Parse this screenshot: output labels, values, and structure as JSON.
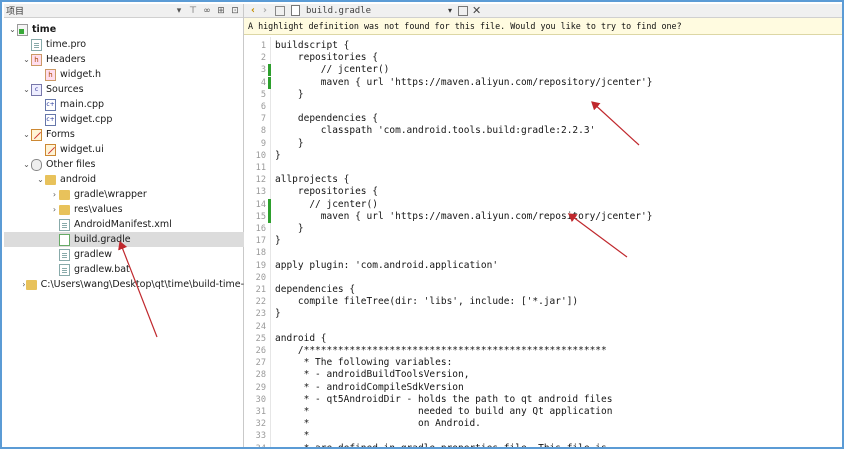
{
  "project_pane": {
    "title": "项目",
    "tree": [
      {
        "label": "time",
        "icon": "project-icon",
        "level": 0,
        "expanded": true,
        "bold": true
      },
      {
        "label": "time.pro",
        "icon": "pro-file-icon",
        "level": 1
      },
      {
        "label": "Headers",
        "icon": "headers-folder-icon",
        "level": 1,
        "expanded": true
      },
      {
        "label": "widget.h",
        "icon": "header-file-icon",
        "level": 2
      },
      {
        "label": "Sources",
        "icon": "sources-folder-icon",
        "level": 1,
        "expanded": true
      },
      {
        "label": "main.cpp",
        "icon": "cpp-file-icon",
        "level": 2
      },
      {
        "label": "widget.cpp",
        "icon": "cpp-file-icon",
        "level": 2
      },
      {
        "label": "Forms",
        "icon": "forms-folder-icon",
        "level": 1,
        "expanded": true
      },
      {
        "label": "widget.ui",
        "icon": "ui-file-icon",
        "level": 2
      },
      {
        "label": "Other files",
        "icon": "other-files-icon",
        "level": 1,
        "expanded": true
      },
      {
        "label": "android",
        "icon": "folder-icon",
        "level": 2,
        "expanded": true
      },
      {
        "label": "gradle\\wrapper",
        "icon": "folder-icon",
        "level": 3,
        "collapsed": true
      },
      {
        "label": "res\\values",
        "icon": "folder-icon",
        "level": 3,
        "collapsed": true
      },
      {
        "label": "AndroidManifest.xml",
        "icon": "xml-file-icon",
        "level": 3
      },
      {
        "label": "build.gradle",
        "icon": "gradle-file-icon",
        "level": 3,
        "selected": true
      },
      {
        "label": "gradlew",
        "icon": "file-icon",
        "level": 3
      },
      {
        "label": "gradlew.bat",
        "icon": "bat-file-icon",
        "level": 3
      },
      {
        "label": "C:\\Users\\wang\\Desktop\\qt\\time\\build-time-",
        "icon": "folder-icon",
        "level": 1,
        "collapsed": true
      }
    ]
  },
  "editor": {
    "file_name": "build.gradle",
    "info_message": "A highlight definition was not found for this file. Would you like to try to find one?",
    "lines": [
      {
        "n": "1",
        "text": "buildscript {"
      },
      {
        "n": "2",
        "text": "    repositories {"
      },
      {
        "n": "3",
        "text": "        // jcenter()",
        "changed": true
      },
      {
        "n": "4",
        "text": "        maven { url 'https://maven.aliyun.com/repository/jcenter'}",
        "changed": true
      },
      {
        "n": "5",
        "text": "    }"
      },
      {
        "n": "6",
        "text": ""
      },
      {
        "n": "7",
        "text": "    dependencies {"
      },
      {
        "n": "8",
        "text": "        classpath 'com.android.tools.build:gradle:2.2.3'"
      },
      {
        "n": "9",
        "text": "    }"
      },
      {
        "n": "10",
        "text": "}"
      },
      {
        "n": "11",
        "text": ""
      },
      {
        "n": "12",
        "text": "allprojects {"
      },
      {
        "n": "13",
        "text": "    repositories {"
      },
      {
        "n": "14",
        "text": "      // jcenter()",
        "changed": true
      },
      {
        "n": "15",
        "text": "        maven { url 'https://maven.aliyun.com/repository/jcenter'}",
        "changed": true
      },
      {
        "n": "16",
        "text": "    }"
      },
      {
        "n": "17",
        "text": "}"
      },
      {
        "n": "18",
        "text": ""
      },
      {
        "n": "19",
        "text": "apply plugin: 'com.android.application'"
      },
      {
        "n": "20",
        "text": ""
      },
      {
        "n": "21",
        "text": "dependencies {"
      },
      {
        "n": "22",
        "text": "    compile fileTree(dir: 'libs', include: ['*.jar'])"
      },
      {
        "n": "23",
        "text": "}"
      },
      {
        "n": "24",
        "text": ""
      },
      {
        "n": "25",
        "text": "android {"
      },
      {
        "n": "26",
        "text": "    /*****************************************************"
      },
      {
        "n": "27",
        "text": "     * The following variables:"
      },
      {
        "n": "28",
        "text": "     * - androidBuildToolsVersion,"
      },
      {
        "n": "29",
        "text": "     * - androidCompileSdkVersion"
      },
      {
        "n": "30",
        "text": "     * - qt5AndroidDir - holds the path to qt android files"
      },
      {
        "n": "31",
        "text": "     *                   needed to build any Qt application"
      },
      {
        "n": "32",
        "text": "     *                   on Android."
      },
      {
        "n": "33",
        "text": "     *"
      },
      {
        "n": "34",
        "text": "     * are defined in gradle.properties file. This file is"
      }
    ]
  },
  "annotation_color": "#c0282d"
}
